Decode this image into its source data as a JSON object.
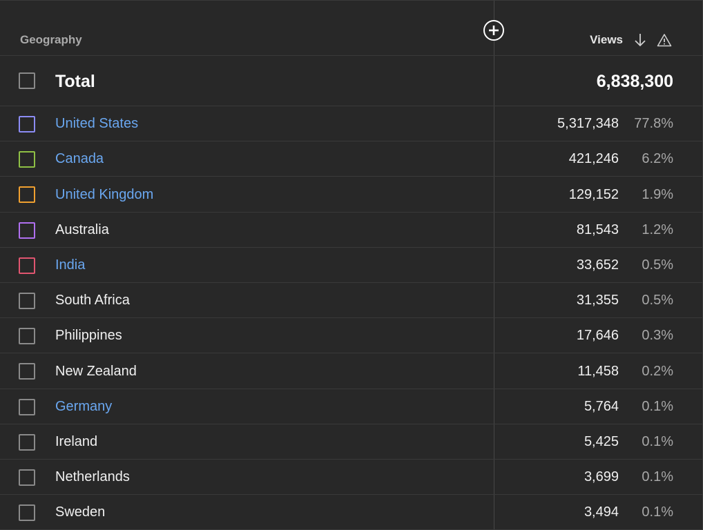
{
  "header": {
    "geography_label": "Geography",
    "views_label": "Views"
  },
  "total": {
    "label": "Total",
    "views": "6,838,300"
  },
  "rows": [
    {
      "name": "United States",
      "views": "5,317,348",
      "percent": "77.8%",
      "link": true,
      "color": "#8c8cf5"
    },
    {
      "name": "Canada",
      "views": "421,246",
      "percent": "6.2%",
      "link": true,
      "color": "#8fc045"
    },
    {
      "name": "United Kingdom",
      "views": "129,152",
      "percent": "1.9%",
      "link": true,
      "color": "#f0a030"
    },
    {
      "name": "Australia",
      "views": "81,543",
      "percent": "1.2%",
      "link": false,
      "color": "#b070f0"
    },
    {
      "name": "India",
      "views": "33,652",
      "percent": "0.5%",
      "link": true,
      "color": "#e05570"
    },
    {
      "name": "South Africa",
      "views": "31,355",
      "percent": "0.5%",
      "link": false,
      "color": "#8a8a8a"
    },
    {
      "name": "Philippines",
      "views": "17,646",
      "percent": "0.3%",
      "link": false,
      "color": "#8a8a8a"
    },
    {
      "name": "New Zealand",
      "views": "11,458",
      "percent": "0.2%",
      "link": false,
      "color": "#8a8a8a"
    },
    {
      "name": "Germany",
      "views": "5,764",
      "percent": "0.1%",
      "link": true,
      "color": "#8a8a8a"
    },
    {
      "name": "Ireland",
      "views": "5,425",
      "percent": "0.1%",
      "link": false,
      "color": "#8a8a8a"
    },
    {
      "name": "Netherlands",
      "views": "3,699",
      "percent": "0.1%",
      "link": false,
      "color": "#8a8a8a"
    },
    {
      "name": "Sweden",
      "views": "3,494",
      "percent": "0.1%",
      "link": false,
      "color": "#8a8a8a"
    }
  ]
}
